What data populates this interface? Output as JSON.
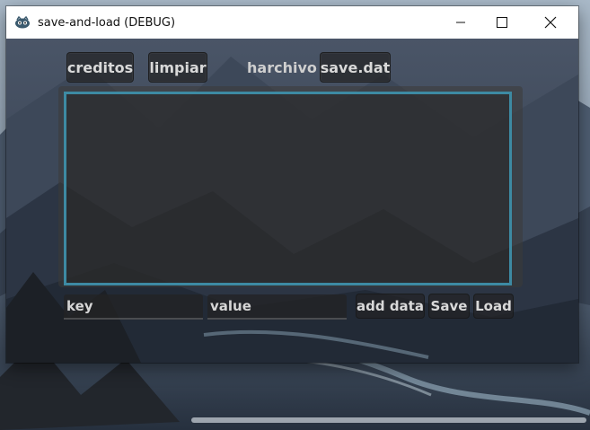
{
  "window": {
    "title": "save-and-load (DEBUG)"
  },
  "toolbar": {
    "credits_label": "creditos",
    "clear_label": "limpiar",
    "file_label": "harchivo",
    "file_name": "save.dat"
  },
  "editor": {
    "text": ""
  },
  "inputs": {
    "key_placeholder": "key",
    "value_placeholder": "value"
  },
  "actions": {
    "add_label": "add data",
    "save_label": "Save",
    "load_label": "Load"
  },
  "colors": {
    "accent_border": "#3d8aa3",
    "titlebar_bg": "#ffffff",
    "button_bg": "#222224"
  }
}
